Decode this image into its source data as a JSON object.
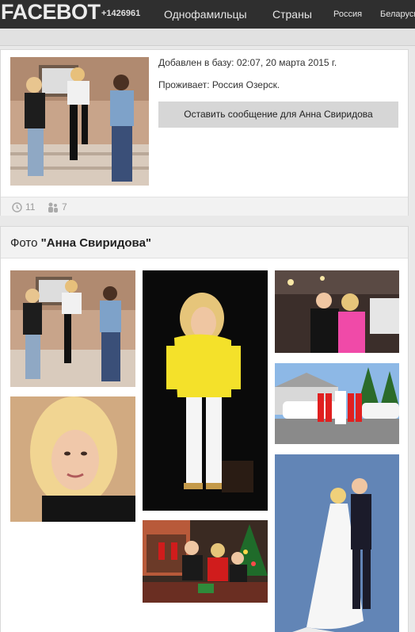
{
  "nav": {
    "brand": "FACEBOT",
    "count": "+1426961",
    "links": [
      "Однофамильцы",
      "Страны",
      "Россия",
      "Беларусь"
    ]
  },
  "profile": {
    "added_label": "Добавлен в базу: 02:07, 20 марта 2015 г.",
    "lives_label": "Проживает: Россия Озерск.",
    "message_button": "Оставить сообщение для Анна Свиридова",
    "views_count": "11",
    "friends_count": "7",
    "icons": {
      "views": "clock-icon",
      "friends": "people-icon"
    }
  },
  "photos": {
    "title_prefix": "Фото ",
    "title_name": "\"Анна Свиридова\"",
    "items": [
      "three-girls-staircase",
      "blonde-portrait",
      "yellow-shirt-girl",
      "couple-restaurant",
      "wedding-limousine",
      "christmas-family",
      "wedding-couple"
    ]
  },
  "colors": {
    "nav_bg": "#2f2f2f",
    "button_bg": "#d6d6d6",
    "page_bg": "#e9e9e9"
  }
}
